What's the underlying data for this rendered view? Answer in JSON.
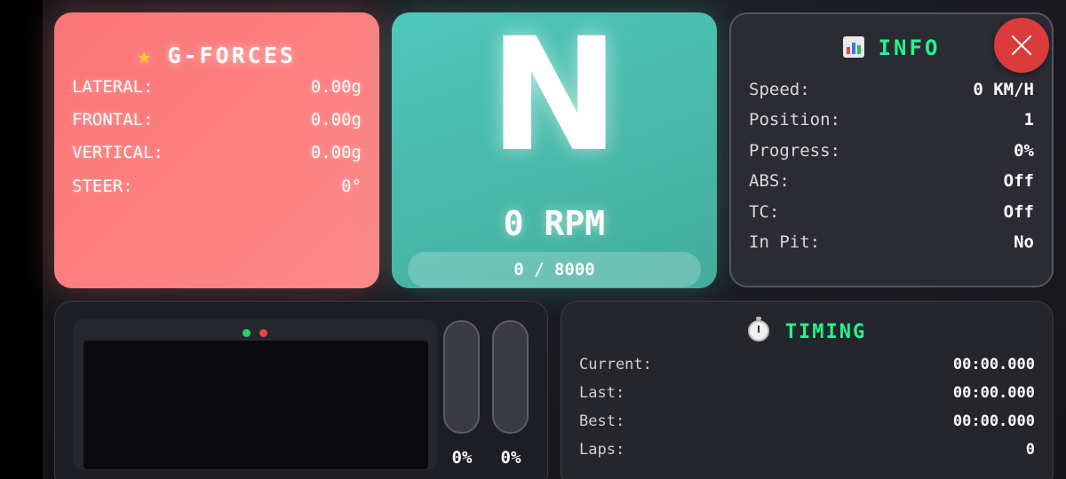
{
  "gforces": {
    "title": "G-FORCES",
    "icon": "star-icon",
    "rows": [
      {
        "label": "LATERAL:",
        "value": "0.00g"
      },
      {
        "label": "FRONTAL:",
        "value": "0.00g"
      },
      {
        "label": "VERTICAL:",
        "value": "0.00g"
      },
      {
        "label": "STEER:",
        "value": "0°"
      }
    ]
  },
  "gear": {
    "value": "N",
    "rpm": "0 RPM",
    "rpm_range": "0 / 8000",
    "rpm_fraction": 0
  },
  "info": {
    "title": "INFO",
    "icon": "bar-chart-icon",
    "rows": [
      {
        "label": "Speed:",
        "value": "0 KM/H"
      },
      {
        "label": "Position:",
        "value": "1"
      },
      {
        "label": "Progress:",
        "value": "0%"
      },
      {
        "label": "ABS:",
        "value": "Off"
      },
      {
        "label": "TC:",
        "value": "Off"
      },
      {
        "label": "In Pit:",
        "value": "No"
      }
    ]
  },
  "pedals": {
    "throttle": "0%",
    "brake": "0%",
    "throttle_fraction": 0,
    "brake_fraction": 0,
    "indicator_colors": [
      "#22d468",
      "#e84545"
    ]
  },
  "timing": {
    "title": "TIMING",
    "icon": "stopwatch-icon",
    "rows": [
      {
        "label": "Current:",
        "value": "00:00.000"
      },
      {
        "label": "Last:",
        "value": "00:00.000"
      },
      {
        "label": "Best:",
        "value": "00:00.000"
      },
      {
        "label": "Laps:",
        "value": "0"
      }
    ]
  },
  "colors": {
    "accent_green": "#21f58f",
    "gforces_bg": "#fb7575",
    "gear_bg": "#4ec7b9",
    "close_red": "#dc3b3b"
  }
}
